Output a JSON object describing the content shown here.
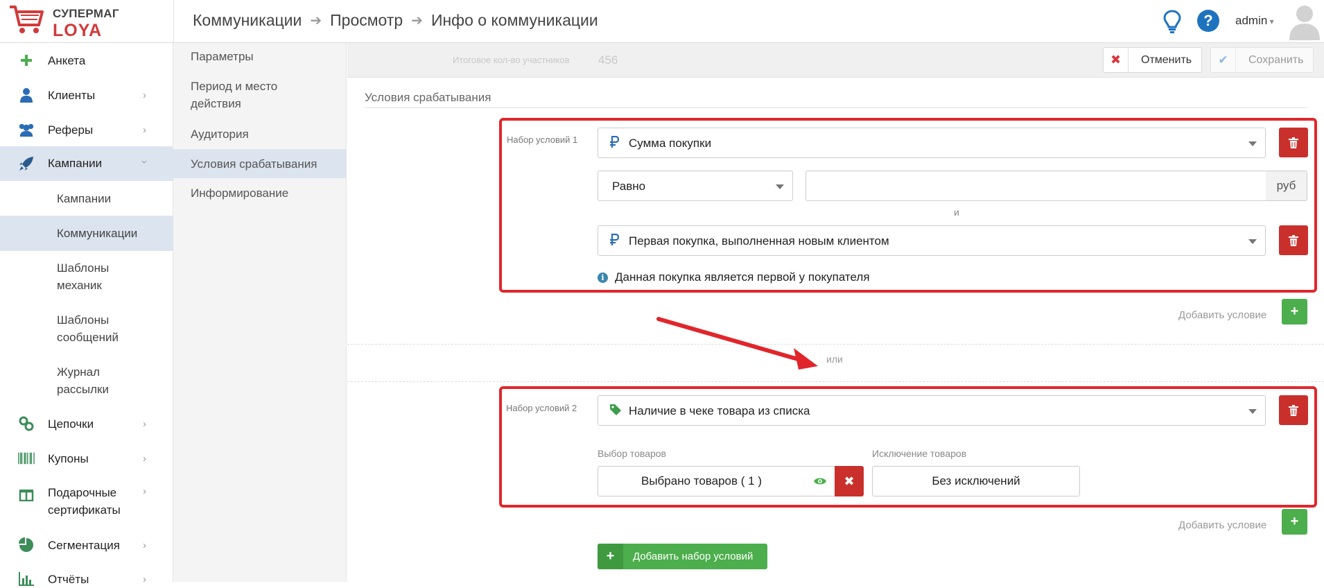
{
  "brand": {
    "line1": "СУПЕРМАГ",
    "line2": "LOYA",
    "accent": "#d13a3a"
  },
  "breadcrumb": [
    "Коммуникации",
    "Просмотр",
    "Инфо о коммуникации"
  ],
  "breadcrumb_separator": "➔",
  "header": {
    "user": "admin",
    "icons": [
      "lightbulb-icon",
      "help-icon",
      "avatar"
    ]
  },
  "sidebar": {
    "items": [
      {
        "label": "Анкета",
        "icon": "plus-icon"
      },
      {
        "label": "Клиенты",
        "icon": "user-icon"
      },
      {
        "label": "Реферы",
        "icon": "users-icon"
      },
      {
        "label": "Кампании",
        "icon": "rocket-icon",
        "expanded": true
      },
      {
        "label": "Цепочки",
        "icon": "link-icon"
      },
      {
        "label": "Купоны",
        "icon": "barcode-icon"
      },
      {
        "label": "Подарочные сертификаты",
        "icon": "gift-icon"
      },
      {
        "label": "Сегментация",
        "icon": "pie-chart-icon"
      },
      {
        "label": "Отчёты",
        "icon": "bar-chart-icon"
      }
    ],
    "sub_items": [
      {
        "label": "Кампании"
      },
      {
        "label": "Коммуникации",
        "active": true
      },
      {
        "label": "Шаблоны механик"
      },
      {
        "label": "Шаблоны сообщений"
      },
      {
        "label": "Журнал рассылки"
      }
    ]
  },
  "subnav": {
    "items": [
      {
        "label": "Параметры"
      },
      {
        "label": "Период и место действия"
      },
      {
        "label": "Аудитория"
      },
      {
        "label": "Условия срабатывания",
        "active": true
      },
      {
        "label": "Информирование"
      }
    ]
  },
  "actionbar": {
    "faded_label": "Итоговое кол-во участников",
    "faded_value": "456",
    "cancel_label": "Отменить",
    "save_label": "Сохранить"
  },
  "section_title": "Условия срабатывания",
  "condition_sets": [
    {
      "label": "Набор условий 1",
      "conditions": [
        {
          "select": "Сумма покупки",
          "icon": "ruble-icon"
        },
        {
          "select": "Первая покупка, выполненная новым клиентом",
          "icon": "ruble-icon"
        }
      ],
      "operator": "Равно",
      "amount_value": "",
      "amount_unit": "руб",
      "and_label": "и",
      "info": "Данная покупка является первой у покупателя",
      "add_condition": "Добавить условие"
    },
    {
      "label": "Набор условий 2",
      "conditions": [
        {
          "select": "Наличие в чеке товара из списка",
          "icon": "tag-icon"
        }
      ],
      "products_caption": "Выбор товаров",
      "products_value": "Выбрано товаров ( 1 )",
      "exclusions_caption": "Исключение товаров",
      "exclusions_value": "Без исключений",
      "add_condition": "Добавить условие"
    }
  ],
  "or_label": "или",
  "add_set_label": "Добавить набор условий",
  "colors": {
    "highlight": "#e0262b",
    "danger": "#c9302c",
    "success": "#4cae4c",
    "active_nav": "#dce4ef"
  }
}
